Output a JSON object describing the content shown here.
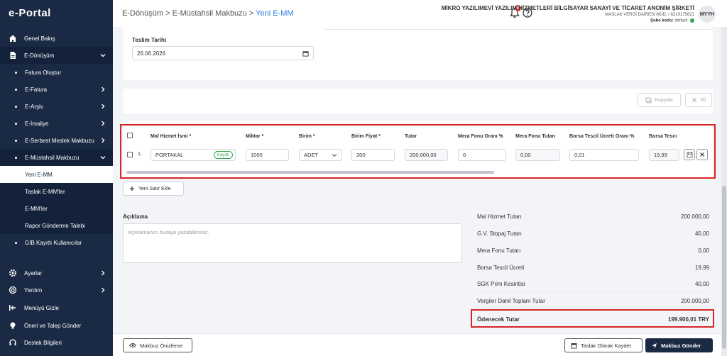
{
  "sidebar": {
    "logo": "e-Portal",
    "items": [
      {
        "label": "Genel Bakış"
      },
      {
        "label": "E-Dönüşüm"
      },
      {
        "label": "Fatura Oluştur"
      },
      {
        "label": "E-Fatura"
      },
      {
        "label": "E-Arşiv"
      },
      {
        "label": "E-İrsaliye"
      },
      {
        "label": "E-Serbest Meslek Makbuzu"
      },
      {
        "label": "E-Müstahsil Makbuzu"
      },
      {
        "label": "Yeni E-MM"
      },
      {
        "label": "Taslak E-MM'ler"
      },
      {
        "label": "E-MM'ler"
      },
      {
        "label": "Rapor Gönderme Talebi"
      },
      {
        "label": "GİB Kayıtlı Kullanıcılar"
      },
      {
        "label": "Ayarlar"
      },
      {
        "label": "Yardım"
      },
      {
        "label": "Menüyü Gizle"
      },
      {
        "label": "Öneri ve Talep Gönder"
      },
      {
        "label": "Destek Bilgileri"
      }
    ]
  },
  "header": {
    "breadcrumb": [
      "E-Dönüşüm",
      "E-Müstahsil Makbuzu",
      "Yeni E-MM"
    ],
    "separator": ">",
    "notif_count": "40",
    "company_name": "MİKRO YAZILIMEVİ YAZILIM HİZMETLERİ BİLGİSAYAR SANAYİ VE TİCARET ANONİM ŞİRKETİ",
    "tax_info": "MASLAK VERGİ DAİRESİ MÜD. / 6210175621",
    "branch_label": "Şube kodu:",
    "branch_value": "default",
    "avatar": "MYYH"
  },
  "delivery": {
    "label": "Teslim Tarihi",
    "value": "26.06.2026"
  },
  "actions": {
    "copy": "Kopyala",
    "delete": "Sil"
  },
  "table": {
    "headers": [
      "Mal Hizmet İsmi *",
      "Miktar *",
      "Birim *",
      "Birim Fiyat *",
      "Tutar",
      "Mera Fonu Oranı %",
      "Mera Fonu Tutarı",
      "Borsa Tescil Ücreti Oranı %",
      "Borsa Tesci"
    ],
    "row": {
      "index": "1.",
      "name": "PORTAKAL",
      "tag": "Kayıtlı",
      "quantity": "1000",
      "unit": "ADET",
      "unit_price": "200",
      "amount": "200.000,00",
      "mera_rate": "0",
      "mera_amount": "0,00",
      "borsa_rate": "0,01",
      "borsa_amount": "19,99"
    },
    "add_row": "Yeni Satır Ekle"
  },
  "description": {
    "label": "Açıklama",
    "placeholder": "Açıklamanızı buraya yazabilirsiniz."
  },
  "summary": [
    {
      "label": "Mal Hizmet Tutarı",
      "value": "200.000,00"
    },
    {
      "label": "G.V. Stopaj Tutarı",
      "value": "40,00"
    },
    {
      "label": "Mera Fonu Tutarı",
      "value": "0,00"
    },
    {
      "label": "Borsa Tescil Ücreti",
      "value": "19,99"
    },
    {
      "label": "SGK Prim Kesintisi",
      "value": "40,00"
    },
    {
      "label": "Vergiler Dahil Toplam Tutar",
      "value": "200.000,00"
    },
    {
      "label": "Ödenecek Tutar",
      "value": "199.900,01 TRY"
    }
  ],
  "footer": {
    "preview": "Makbuz Önizleme",
    "save_draft": "Taslak Olarak Kaydet",
    "send": "Makbuz Gönder"
  }
}
